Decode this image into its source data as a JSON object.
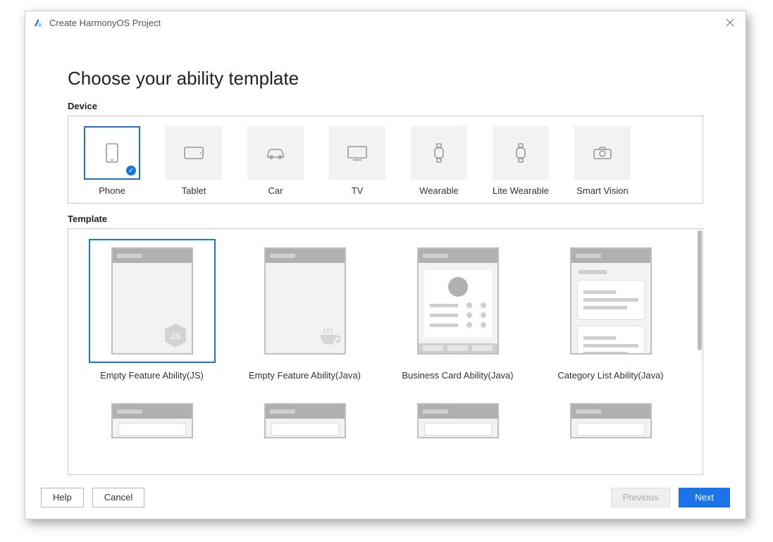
{
  "window": {
    "title": "Create HarmonyOS Project"
  },
  "page": {
    "heading": "Choose your ability template",
    "device_label": "Device",
    "template_label": "Template"
  },
  "devices": [
    {
      "label": "Phone",
      "icon": "phone-icon",
      "selected": true
    },
    {
      "label": "Tablet",
      "icon": "tablet-icon",
      "selected": false
    },
    {
      "label": "Car",
      "icon": "car-icon",
      "selected": false
    },
    {
      "label": "TV",
      "icon": "tv-icon",
      "selected": false
    },
    {
      "label": "Wearable",
      "icon": "wearable-icon",
      "selected": false
    },
    {
      "label": "Lite Wearable",
      "icon": "wearable-icon",
      "selected": false
    },
    {
      "label": "Smart Vision",
      "icon": "camera-icon",
      "selected": false
    }
  ],
  "templates": [
    {
      "label": "Empty Feature Ability(JS)",
      "kind": "empty-js",
      "selected": true
    },
    {
      "label": "Empty Feature Ability(Java)",
      "kind": "empty-java",
      "selected": false
    },
    {
      "label": "Business Card Ability(Java)",
      "kind": "business",
      "selected": false
    },
    {
      "label": "Category List Ability(Java)",
      "kind": "category",
      "selected": false
    },
    {
      "label": "",
      "kind": "peek",
      "selected": false
    },
    {
      "label": "",
      "kind": "peek",
      "selected": false
    },
    {
      "label": "",
      "kind": "peek",
      "selected": false
    },
    {
      "label": "",
      "kind": "peek",
      "selected": false
    }
  ],
  "footer": {
    "help": "Help",
    "cancel": "Cancel",
    "previous": "Previous",
    "next": "Next",
    "previous_enabled": false
  },
  "colors": {
    "accent": "#1a73e8"
  }
}
